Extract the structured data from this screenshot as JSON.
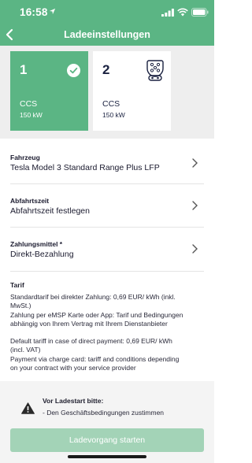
{
  "status_bar": {
    "time": "16:58"
  },
  "nav": {
    "title": "Ladeeinstellungen"
  },
  "connectors": [
    {
      "number": "1",
      "type": "CCS",
      "power": "150 kW",
      "selected": true
    },
    {
      "number": "2",
      "type": "CCS",
      "power": "150 kW",
      "selected": false
    }
  ],
  "fields": {
    "vehicle": {
      "label": "Fahrzeug",
      "value": "Tesla Model 3 Standard Range Plus LFP"
    },
    "departure": {
      "label": "Abfahrtszeit",
      "value": "Abfahrtszeit festlegen"
    },
    "payment": {
      "label": "Zahlungsmittel *",
      "value": "Direkt-Bezahlung"
    }
  },
  "tarif": {
    "title": "Tarif",
    "lines": [
      "Standardtarif bei direkter Zahlung: 0,69 EUR/ kWh (inkl.",
      "MwSt.)",
      "Zahlung per eMSP Karte oder App: Tarif und Bedingungen",
      "abhängig von Ihrem Vertrag mit Ihrem Dienstanbieter",
      "Default tariff in case of direct payment: 0,69 EUR/ kWh",
      "(incl. VAT)",
      "Payment via charge card: tariff and conditions depending",
      "on your contract with your service provider"
    ]
  },
  "warning": {
    "title": "Vor Ladestart bitte:",
    "text": "- Den Geschäftsbedingungen zustimmen"
  },
  "start_button": {
    "label": "Ladevorgang starten"
  },
  "colors": {
    "brand_green": "#5bb584",
    "button_disabled": "#a3d3b7"
  }
}
